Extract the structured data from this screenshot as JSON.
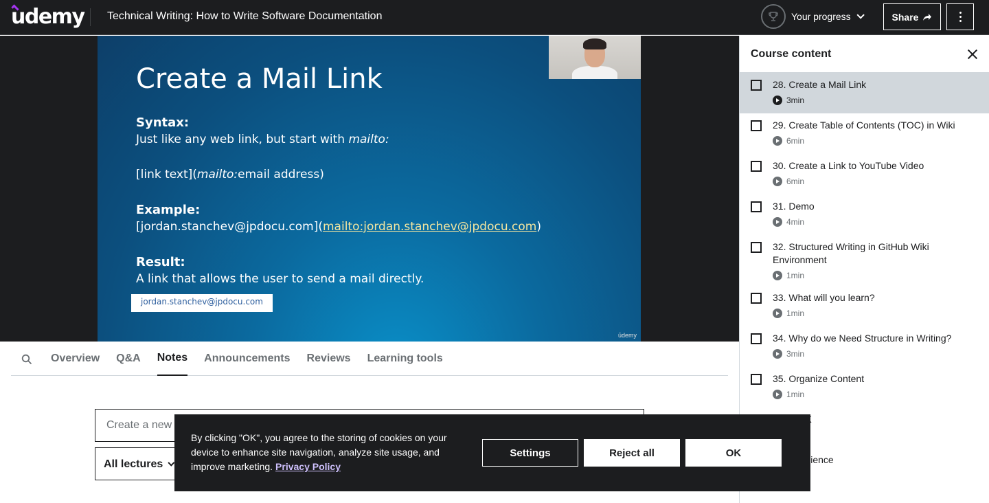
{
  "header": {
    "logo": "udemy",
    "course_title": "Technical Writing: How to Write Software Documentation",
    "progress_label": "Your progress",
    "share_label": "Share"
  },
  "slide": {
    "title": "Create a Mail Link",
    "syntax_heading": "Syntax:",
    "syntax_text": "Just like any web link, but start with ",
    "syntax_italic": "mailto:",
    "syntax_format_a": "[link text](",
    "syntax_format_italic": "mailto:",
    "syntax_format_b": "email address)",
    "example_heading": "Example:",
    "example_text_a": "[jordan.stanchev@jpdocu.com](",
    "example_link": "mailto:jordan.stanchev@jpdocu.com",
    "example_text_b": ")",
    "result_heading": "Result:",
    "result_text": "A link that allows the user to send a mail directly.",
    "link_box": "jordan.stanchev@jpdocu.com",
    "brand": "ūdemy"
  },
  "tabs": [
    {
      "label": "Overview"
    },
    {
      "label": "Q&A"
    },
    {
      "label": "Notes"
    },
    {
      "label": "Announcements"
    },
    {
      "label": "Reviews"
    },
    {
      "label": "Learning tools"
    }
  ],
  "notes": {
    "input_text": "Create a new",
    "filter_label": "All lectures"
  },
  "sidebar": {
    "title": "Course content",
    "lectures": [
      {
        "title": "28. Create a Mail Link",
        "duration": "3min"
      },
      {
        "title": "29. Create Table of Contents (TOC) in Wiki",
        "duration": "6min"
      },
      {
        "title": "30. Create a Link to YouTube Video",
        "duration": "6min"
      },
      {
        "title": "31. Demo",
        "duration": "4min"
      },
      {
        "title": "32. Structured Writing in GitHub Wiki Environment",
        "duration": "1min"
      },
      {
        "title": "33. What will you learn?",
        "duration": "1min"
      },
      {
        "title": "34. Why do we Need Structure in Writing?",
        "duration": "3min"
      },
      {
        "title": "35. Organize Content",
        "duration": "1min"
      },
      {
        "title": "istent UX"
      },
      {
        "title": "ve Experience"
      }
    ]
  },
  "cookie": {
    "text": "By clicking \"OK\", you agree to the storing of cookies on your device to enhance site navigation, analyze site usage, and improve marketing.",
    "privacy_label": "Privacy Policy",
    "settings_label": "Settings",
    "reject_label": "Reject all",
    "ok_label": "OK"
  }
}
